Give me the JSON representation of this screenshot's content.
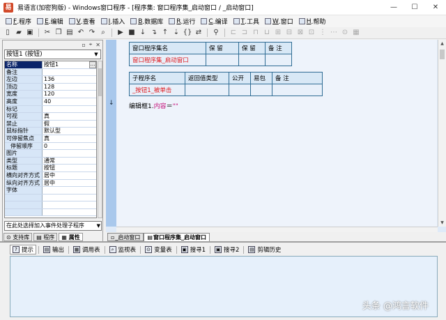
{
  "window": {
    "title": "易语言(加密狗版) - Windows窗口程序 - [程序集: 窗口程序集_启动窗口 / _启动窗口]",
    "app_icon": "易",
    "controls": {
      "minimize": "—",
      "maximize": "☐",
      "close": "✕"
    }
  },
  "menu": [
    {
      "key": "F",
      "label": ".程序"
    },
    {
      "key": "E",
      "label": ".编辑"
    },
    {
      "key": "V",
      "label": ".查看"
    },
    {
      "key": "I",
      "label": ".插入"
    },
    {
      "key": "B",
      "label": ".数据库"
    },
    {
      "key": "R",
      "label": ".运行"
    },
    {
      "key": "C",
      "label": ".编译"
    },
    {
      "key": "T",
      "label": ".工具"
    },
    {
      "key": "W",
      "label": ".窗口"
    },
    {
      "key": "H",
      "label": ".帮助"
    }
  ],
  "toolbar": [
    {
      "name": "new-icon",
      "glyph": "▯"
    },
    {
      "name": "open-icon",
      "glyph": "▰"
    },
    {
      "name": "save-icon",
      "glyph": "▣"
    },
    {
      "name": "cut-icon",
      "glyph": "✂"
    },
    {
      "name": "copy-icon",
      "glyph": "❐"
    },
    {
      "name": "paste-icon",
      "glyph": "▤"
    },
    {
      "name": "undo-icon",
      "glyph": "↶"
    },
    {
      "name": "redo-icon",
      "glyph": "↷"
    },
    {
      "name": "find-icon",
      "glyph": "⌕"
    },
    {
      "name": "run-icon",
      "glyph": "▶"
    },
    {
      "name": "stop-icon",
      "glyph": "■"
    },
    {
      "name": "step-in-icon",
      "glyph": "↓"
    },
    {
      "name": "step-over-icon",
      "glyph": "↴"
    },
    {
      "name": "step-out-icon",
      "glyph": "↑"
    },
    {
      "name": "run-to-cursor-icon",
      "glyph": "⇣"
    },
    {
      "name": "breakpoint-icon",
      "glyph": "{}"
    },
    {
      "name": "toggle-icon",
      "glyph": "⇄"
    },
    {
      "name": "binoculars-icon",
      "glyph": "⚲"
    },
    {
      "name": "align-left-icon",
      "glyph": "⊏"
    },
    {
      "name": "align-center-icon",
      "glyph": "⊐"
    },
    {
      "name": "align-right-icon",
      "glyph": "⊓"
    },
    {
      "name": "align-top-icon",
      "glyph": "⊔"
    },
    {
      "name": "align-bottom-icon",
      "glyph": "⊞"
    },
    {
      "name": "same-width-icon",
      "glyph": "⊟"
    },
    {
      "name": "same-height-icon",
      "glyph": "⊠"
    },
    {
      "name": "same-size-icon",
      "glyph": "⊡"
    },
    {
      "name": "hspace-icon",
      "glyph": "⋮"
    },
    {
      "name": "vspace-icon",
      "glyph": "⋯"
    },
    {
      "name": "lock-icon",
      "glyph": "⊙"
    },
    {
      "name": "grid-icon",
      "glyph": "▦"
    }
  ],
  "left_panel": {
    "header_buttons": [
      "▫",
      "⌖",
      "✕"
    ],
    "object_selector": "按钮1 (按钮)",
    "properties": [
      {
        "name": "名称",
        "value": "按钮1",
        "selected": true,
        "button": "…"
      },
      {
        "name": "备注",
        "value": ""
      },
      {
        "name": "左边",
        "value": "136"
      },
      {
        "name": "顶边",
        "value": "128"
      },
      {
        "name": "宽度",
        "value": "120"
      },
      {
        "name": "高度",
        "value": "40"
      },
      {
        "name": "标记",
        "value": ""
      },
      {
        "name": "可视",
        "value": "真"
      },
      {
        "name": "禁止",
        "value": "假"
      },
      {
        "name": "鼠标指针",
        "value": "默认型"
      },
      {
        "name": "可停留焦点",
        "value": "真"
      },
      {
        "name": "停留顺序",
        "value": "0",
        "indent": true
      },
      {
        "name": "图片",
        "value": ""
      },
      {
        "name": "类型",
        "value": "通常"
      },
      {
        "name": "标题",
        "value": "按钮"
      },
      {
        "name": "横向对齐方式",
        "value": "居中"
      },
      {
        "name": "纵向对齐方式",
        "value": "居中"
      },
      {
        "name": "字体",
        "value": ""
      },
      {
        "name": "",
        "value": ""
      },
      {
        "name": "",
        "value": ""
      },
      {
        "name": "",
        "value": ""
      }
    ],
    "event_selector": "在此处选择加入事件处理子程序",
    "tabs": [
      {
        "label": "支持库",
        "icon": "⊙"
      },
      {
        "label": "程序",
        "icon": "▤"
      },
      {
        "label": "属性",
        "icon": "▦",
        "active": true
      }
    ]
  },
  "editor": {
    "assembly_table": {
      "headers": [
        "窗口程序集名",
        "保 留",
        "保 留",
        "备 注"
      ],
      "row": [
        "窗口程序集_启动窗口",
        "",
        "",
        ""
      ]
    },
    "sub_table": {
      "headers": [
        "子程序名",
        "返回值类型",
        "公开",
        "易包",
        "备 注"
      ],
      "row": [
        "_按钮1_被单击",
        "",
        "",
        "",
        ""
      ]
    },
    "code": {
      "object": "编辑框1.",
      "prop": "内容",
      "op": "＝",
      "str": "\"\""
    },
    "gutter_arrow": "↓",
    "tabs": [
      {
        "label": "_启动窗口",
        "icon": "▫"
      },
      {
        "label": "窗口程序集_启动窗口",
        "icon": "▤",
        "active": true
      }
    ]
  },
  "bottom": {
    "tabs": [
      {
        "label": "提示",
        "icon": "?",
        "active": true
      },
      {
        "label": "输出",
        "icon": "▤"
      },
      {
        "label": "调用表",
        "icon": "▦"
      },
      {
        "label": "监视表",
        "icon": "⌕"
      },
      {
        "label": "变量表",
        "icon": "⊙"
      },
      {
        "label": "搜寻1",
        "icon": "▣"
      },
      {
        "label": "搜寻2",
        "icon": "▣"
      },
      {
        "label": "剪辑历史",
        "icon": "▤"
      }
    ]
  },
  "watermark": "头条 @鸿言软件"
}
